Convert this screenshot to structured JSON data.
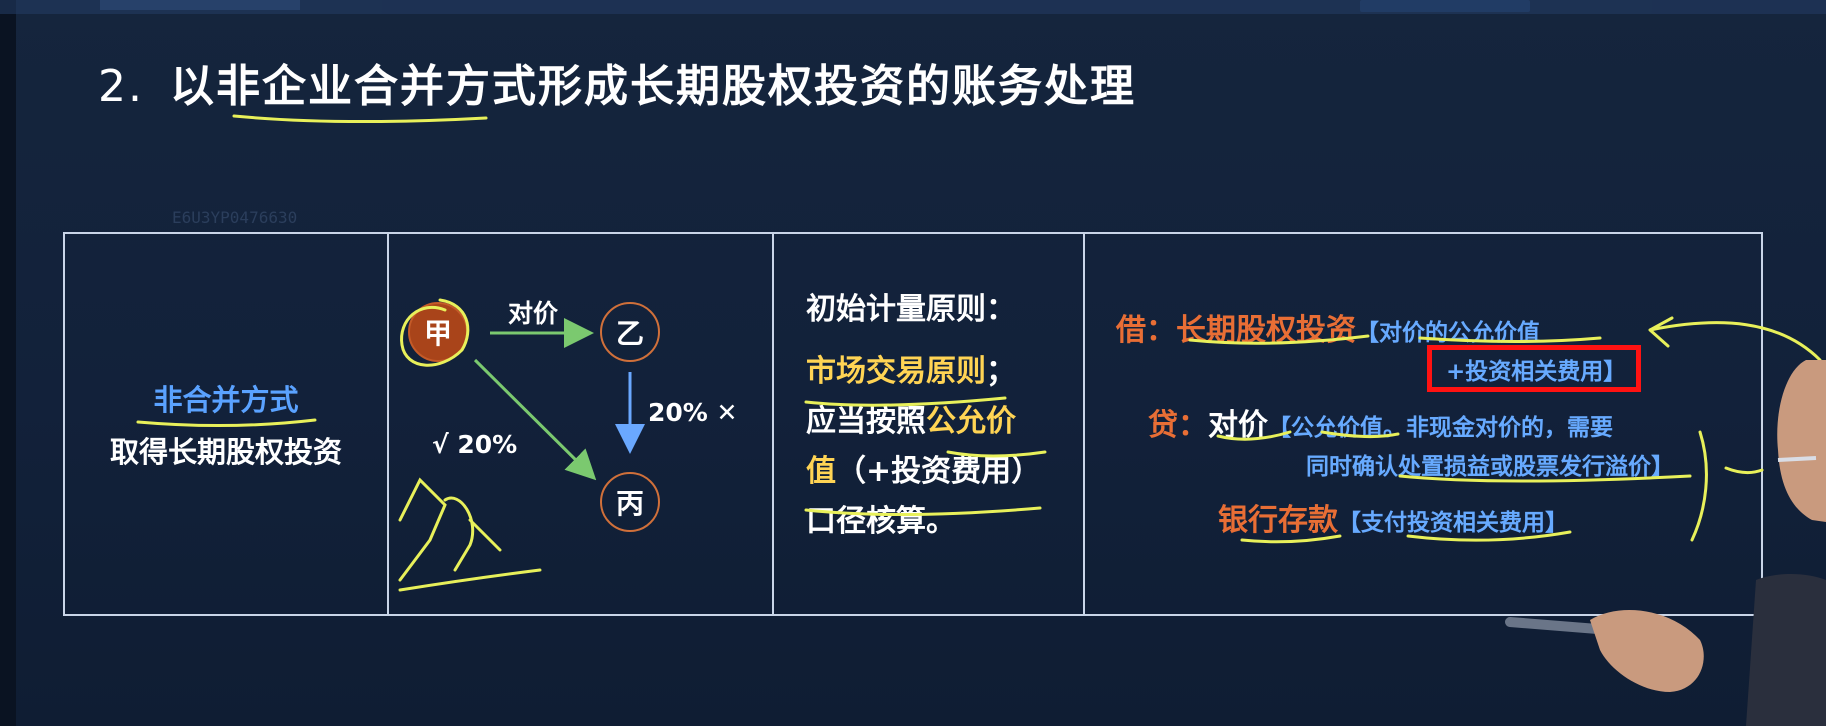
{
  "title": {
    "number": "2.",
    "text": "以非企业合并方式形成长期股权投资的账务处理"
  },
  "watermark": "E6U3YP0476630",
  "column1": {
    "main_label": "非合并方式",
    "sub_label": "取得长期股权投资"
  },
  "diagram": {
    "nodes": {
      "jia": "甲",
      "yi": "乙",
      "bing": "丙"
    },
    "edge_label_consideration": "对价",
    "label_yi_to_bing": "20% ✕",
    "label_jia_to_bing": "√ 20%"
  },
  "column3": {
    "heading": "初始计量原则：",
    "line_market": "市场交易原则",
    "line_market_punct": "；",
    "line_should": "应当按照",
    "line_fair": "公允价",
    "line_value": "值",
    "line_fee": "（+投资费用）",
    "line_end": "口径核算。"
  },
  "column4": {
    "debit_label": "借：",
    "debit_account": "长期股权投资",
    "debit_note_1": "【对价的公允价值",
    "debit_note_2": "+投资相关费用】",
    "credit_label": "贷：",
    "credit_account": "对价",
    "credit_note_1": "【公允价值。非现金对价的，需要",
    "credit_note_2": "同时确认处置损益或股票发行溢价】",
    "bank_account": "银行存款",
    "bank_note": "【支付投资相关费用】"
  },
  "colors": {
    "background": "#14233b",
    "border": "#c9d5e8",
    "accent_blue": "#67aaff",
    "accent_orange": "#e86e35",
    "highlight_yellow": "#ffd454",
    "annotation_box": "#ff1212",
    "node_fill": "#a9441a",
    "arrow_green": "#7bc96f"
  }
}
